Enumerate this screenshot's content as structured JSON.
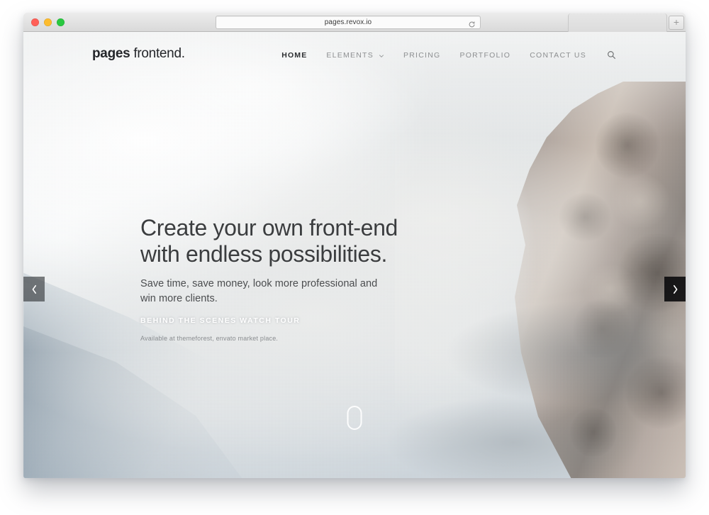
{
  "browser": {
    "url": "pages.revox.io",
    "reload_icon": "reload-icon",
    "newtab_label": "+",
    "traffic_lights": [
      "close",
      "minimize",
      "maximize"
    ]
  },
  "site": {
    "logo": {
      "bold": "pages",
      "light": " frontend."
    },
    "nav": {
      "items": [
        {
          "label": "HOME",
          "active": true,
          "has_caret": false
        },
        {
          "label": "ELEMENTS",
          "active": false,
          "has_caret": true
        },
        {
          "label": "PRICING",
          "active": false,
          "has_caret": false
        },
        {
          "label": "PORTFOLIO",
          "active": false,
          "has_caret": false
        },
        {
          "label": "CONTACT US",
          "active": false,
          "has_caret": false
        }
      ],
      "search_icon": "search-icon"
    },
    "hero": {
      "heading_line1": "Create your own front-end",
      "heading_line2": "with endless possibilities.",
      "subheading": "Save time, save money, look more professional and win more clients.",
      "cta_label": "BEHIND THE SCENES WATCH TOUR",
      "fine_print": "Available at themeforest, envato market place."
    },
    "carousel": {
      "prev_label": "‹",
      "next_label": "›"
    },
    "scroll_indicator": "mouse-scroll-indicator"
  },
  "colors": {
    "heading_text": "#3b3d3f",
    "body_text": "#4b4d4f",
    "nav_inactive": "#8d8f91",
    "nav_active": "#2c2e31",
    "cta_text": "#ffffff",
    "fine_print": "#8a8d90",
    "arrow_prev_bg": "rgba(46,50,54,.62)",
    "arrow_next_bg": "rgba(8,8,10,.88)",
    "page_bg": "#ffffff",
    "chrome_bg": "#e9eaec"
  }
}
